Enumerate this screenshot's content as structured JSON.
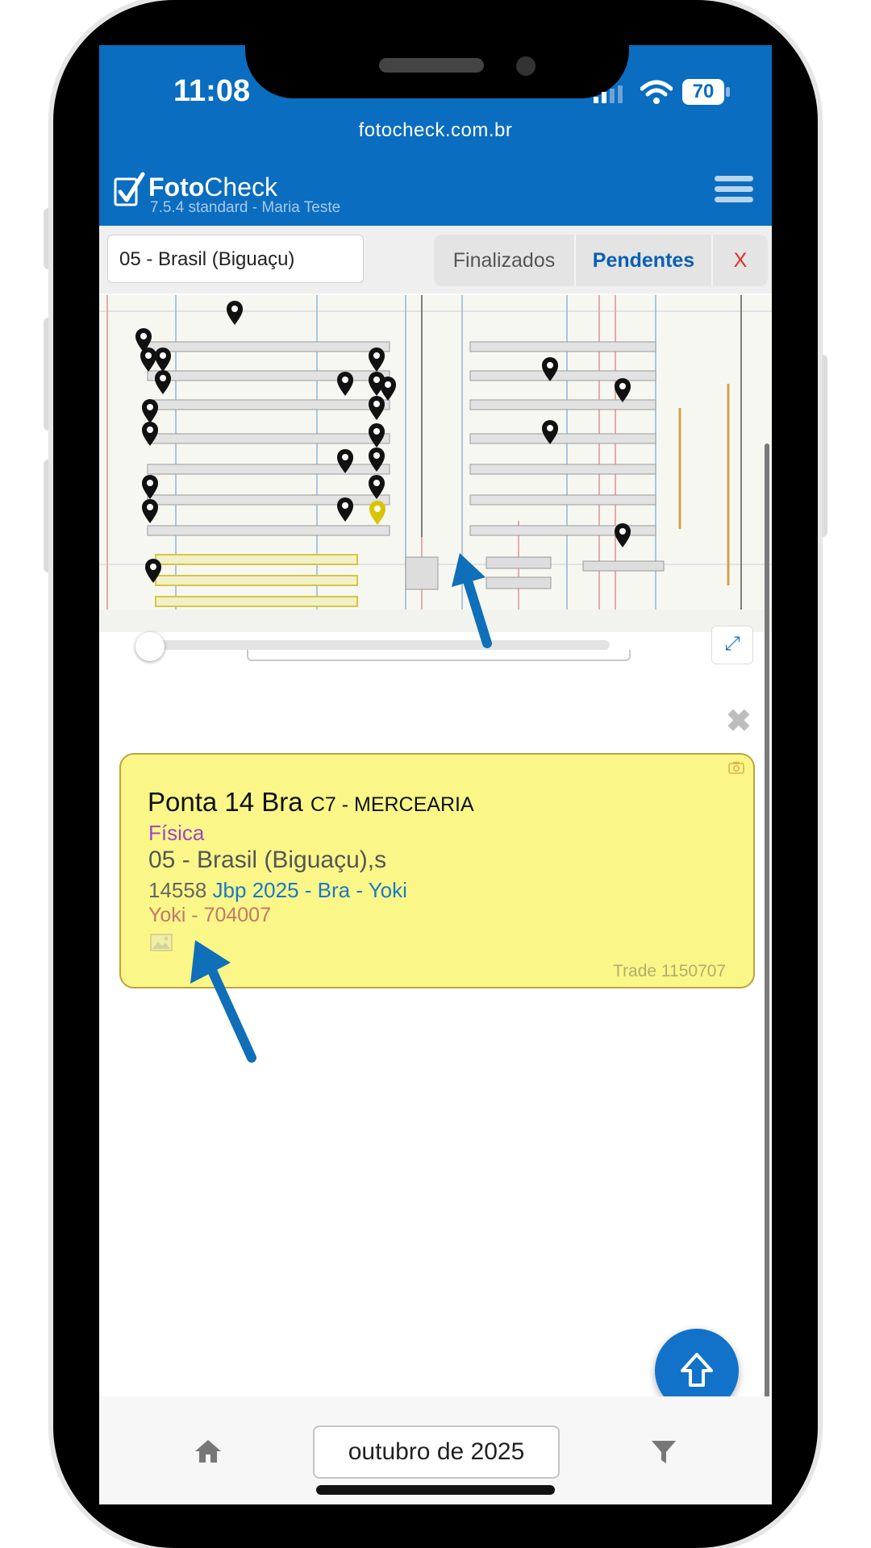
{
  "status_bar": {
    "time": "11:08",
    "battery": "70"
  },
  "browser": {
    "url": "fotocheck.com.br"
  },
  "app": {
    "brand_bold": "Foto",
    "brand_rest": "Check",
    "subtitle": "7.5.4 standard - Maria Teste"
  },
  "filters": {
    "store": "05 - Brasil (Biguaçu)",
    "tabs": [
      {
        "label": "Finalizados",
        "active": false
      },
      {
        "label": "Pendentes",
        "active": true
      },
      {
        "label": "X"
      }
    ]
  },
  "card": {
    "title_main": "Ponta 14 Bra",
    "title_section": "C7 - MERCEARIA",
    "type": "Física",
    "store": "05 - Brasil (Biguaçu),s",
    "id": "14558",
    "campaign": "Jbp 2025 - Bra - Yoki",
    "brand": "Yoki - 704007",
    "trade": "Trade 1150707"
  },
  "bottom_bar": {
    "month": "outubro de 2025"
  },
  "colors": {
    "header_blue": "#0a6dbf",
    "card_yellow": "#faf788",
    "accent_blue": "#1272c9",
    "pin_black": "#111111",
    "pin_selected": "#d9c400",
    "annotation_arrow": "#0f6fb8"
  }
}
